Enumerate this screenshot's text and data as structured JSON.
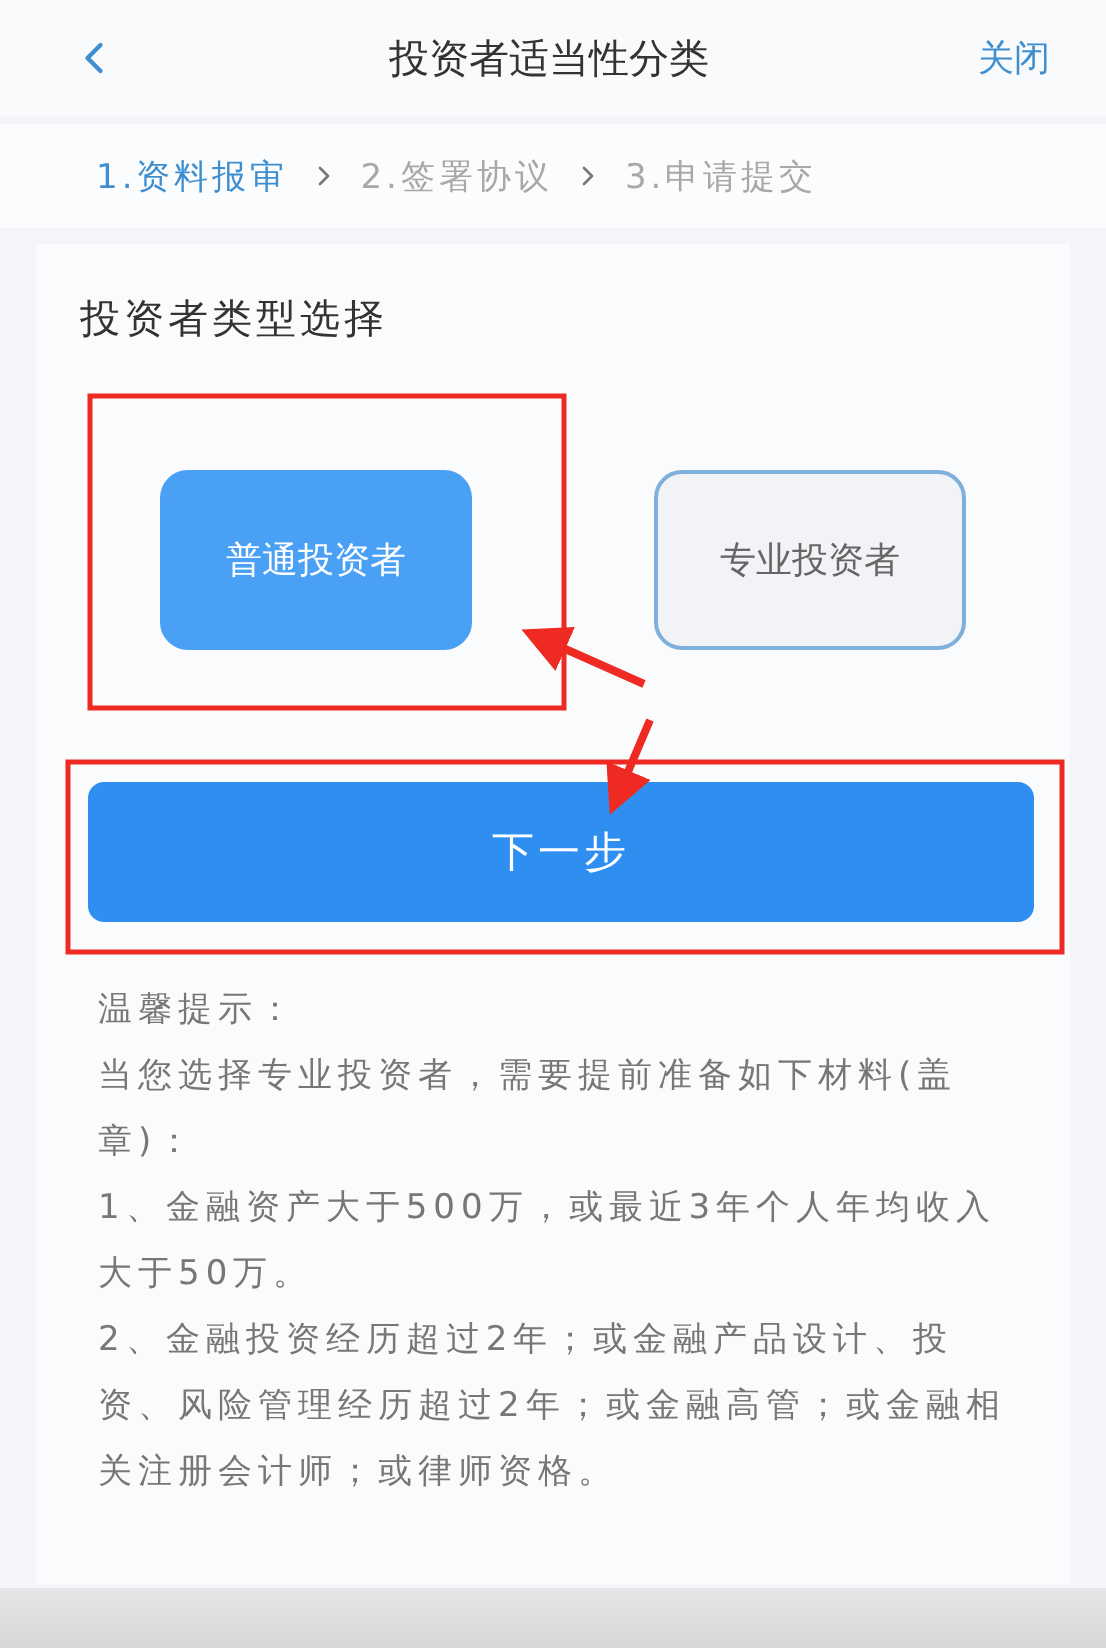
{
  "nav": {
    "title": "投资者适当性分类",
    "close": "关闭"
  },
  "steps": [
    {
      "label": "1.资料报审",
      "selected": true
    },
    {
      "label": "2.签署协议",
      "selected": false
    },
    {
      "label": "3.申请提交",
      "selected": false
    }
  ],
  "section": {
    "heading": "投资者类型选择"
  },
  "investor_types": [
    {
      "label": "普通投资者",
      "selected": true
    },
    {
      "label": "专业投资者",
      "selected": false
    }
  ],
  "next_button": "下一步",
  "tips": {
    "title": "温馨提示：",
    "paragraphs": [
      "当您选择专业投资者，需要提前准备如下材料(盖章)：",
      "1、金融资产大于500万，或最近3年个人年均收入大于50万。",
      "2、金融投资经历超过2年；或金融产品设计、投资、风险管理经历超过2年；或金融高管；或金融相关注册会计师；或律师资格。"
    ]
  }
}
